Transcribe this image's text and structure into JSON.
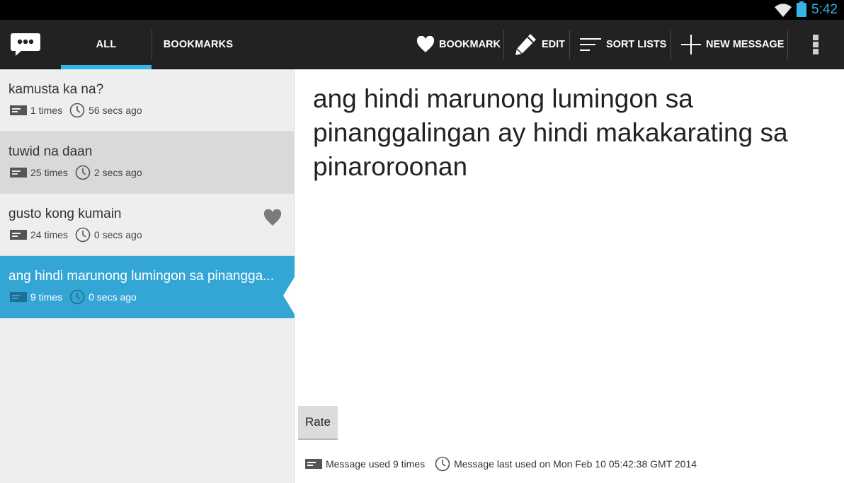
{
  "status_bar": {
    "time": "5:42",
    "accent_color": "#33b5e5"
  },
  "action_bar": {
    "app_icon": "chat-bubble-icon",
    "tabs": [
      {
        "label": "ALL",
        "selected": true
      },
      {
        "label": "BOOKMARKS",
        "selected": false
      }
    ],
    "actions": {
      "bookmark": "BOOKMARK",
      "edit": "EDIT",
      "sort": "SORT LISTS",
      "new_message": "NEW MESSAGE"
    }
  },
  "list": {
    "items": [
      {
        "title": "kamusta ka na?",
        "times": "1 times",
        "ago": "56 secs ago",
        "bookmarked": false,
        "state": "normal"
      },
      {
        "title": "tuwid na daan",
        "times": "25 times",
        "ago": "2 secs ago",
        "bookmarked": false,
        "state": "pressed"
      },
      {
        "title": "gusto kong kumain",
        "times": "24 times",
        "ago": "0 secs ago",
        "bookmarked": true,
        "state": "normal"
      },
      {
        "title": "ang hindi marunong lumingon sa pinangga...",
        "times": "9 times",
        "ago": "0 secs ago",
        "bookmarked": false,
        "state": "selected"
      }
    ]
  },
  "detail": {
    "message": "ang hindi marunong lumingon sa pinanggalingan ay hindi makakarating sa pinaroroonan",
    "rate_label": "Rate",
    "usage_text": "Message used 9 times",
    "last_used_text": "Message last used on Mon Feb 10 05:42:38 GMT 2014"
  },
  "colors": {
    "action_bar_bg": "#222222",
    "selected_row": "#33a6d6",
    "list_bg": "#eeeeee"
  }
}
